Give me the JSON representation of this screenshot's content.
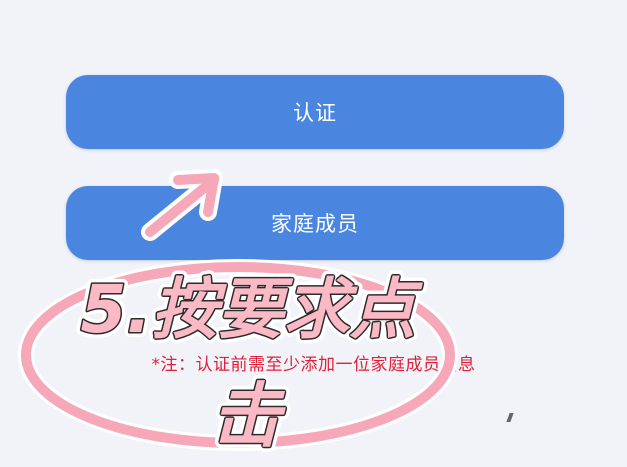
{
  "buttons": {
    "verify_label": "认证",
    "family_label": "家庭成员"
  },
  "note": "*注：认证前需至少添加一位家庭成员信息",
  "annotation": {
    "line1": "5.按要求点",
    "line2": "击"
  },
  "colors": {
    "button": "#4a86df",
    "note_text": "#e0203a",
    "sticker_fill": "#fbb9c6",
    "sticker_outline": "#ffffff",
    "sticker_ring": "#f6a8b9"
  }
}
